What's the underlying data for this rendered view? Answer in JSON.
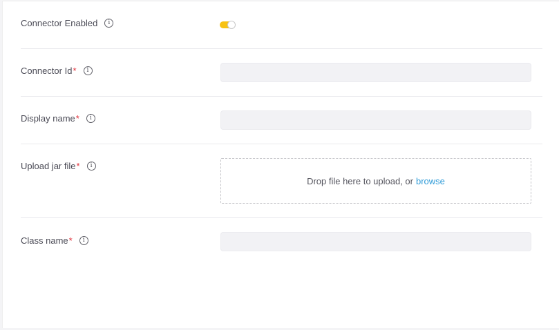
{
  "form": {
    "connector_enabled": {
      "label": "Connector Enabled",
      "info_icon": "info-icon",
      "toggle_on": true,
      "toggle_color": "#f7c213"
    },
    "connector_id": {
      "label": "Connector Id",
      "required_mark": "*",
      "info_icon": "info-icon",
      "value": ""
    },
    "display_name": {
      "label": "Display name",
      "required_mark": "*",
      "info_icon": "info-icon",
      "value": ""
    },
    "upload_jar": {
      "label": "Upload jar file",
      "required_mark": "*",
      "info_icon": "info-icon",
      "drop_text": "Drop file here to upload, or",
      "browse_label": "browse"
    },
    "class_name": {
      "label": "Class name",
      "required_mark": "*",
      "info_icon": "info-icon",
      "value": ""
    }
  },
  "colors": {
    "required": "#e0303a",
    "link": "#2f9bd8",
    "input_bg": "#f2f2f5"
  },
  "info_glyph": "i"
}
